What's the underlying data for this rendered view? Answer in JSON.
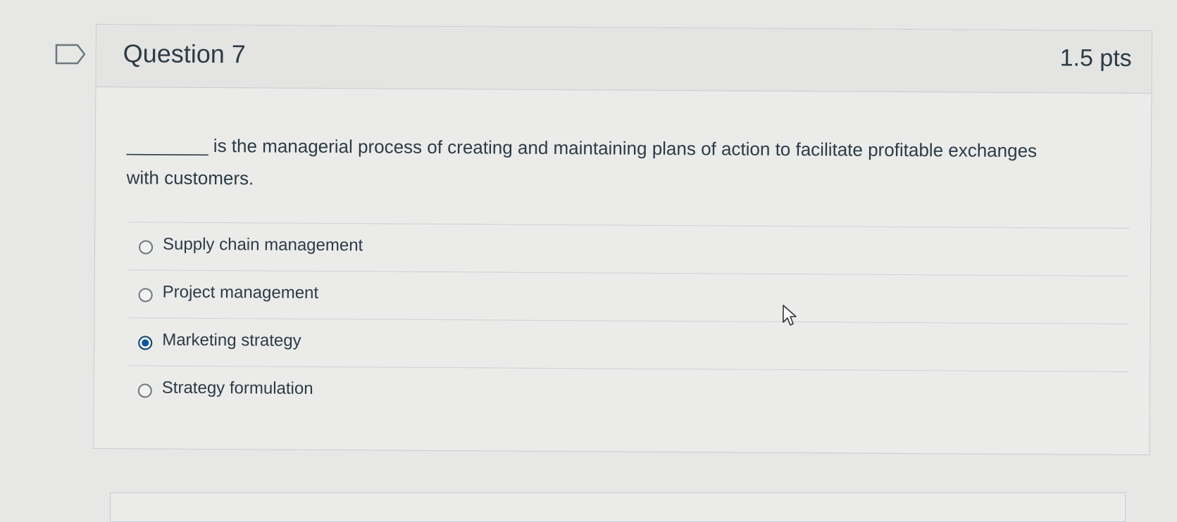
{
  "question": {
    "title": "Question 7",
    "points": "1.5 pts",
    "text": "________ is the managerial process of creating and maintaining plans of action to facilitate profitable exchanges with customers."
  },
  "answers": [
    {
      "label": "Supply chain management",
      "selected": false
    },
    {
      "label": "Project management",
      "selected": false
    },
    {
      "label": "Marketing strategy",
      "selected": true
    },
    {
      "label": "Strategy formulation",
      "selected": false
    }
  ],
  "icons": {
    "flag": "flag-icon",
    "cursor": "mouse-pointer-icon"
  },
  "colors": {
    "selected_radio": "#0a55a5",
    "text": "#2d3b45",
    "border": "#c7cdd1"
  }
}
